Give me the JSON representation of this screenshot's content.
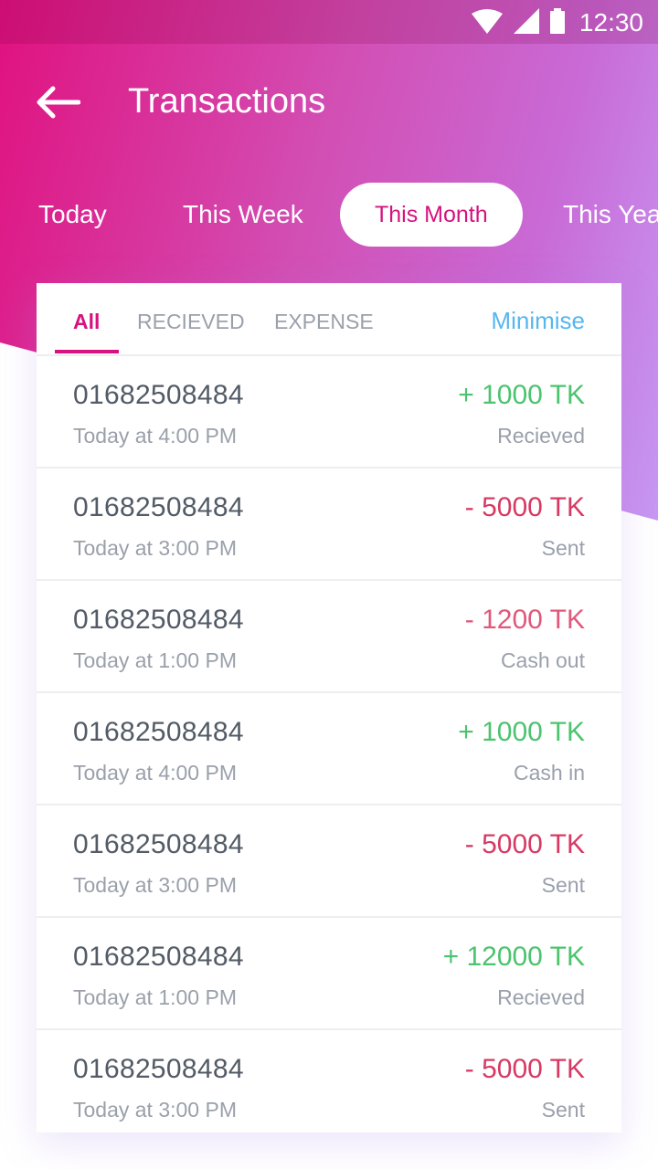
{
  "status": {
    "time": "12:30"
  },
  "header": {
    "title": "Transactions"
  },
  "period_tabs": [
    "Today",
    "This Week",
    "This Month",
    "This Year"
  ],
  "active_period": "This Month",
  "filter_tabs": [
    "All",
    "RECIEVED",
    "EXPENSE"
  ],
  "active_filter": "All",
  "minimise_label": "Minimise",
  "colors": {
    "accent": "#d6127f",
    "received": "#4cc36e",
    "expense": "#d63a63",
    "cashout": "#e0587a",
    "link": "#56b6f2"
  },
  "transactions": [
    {
      "number": "01682508484",
      "time": "Today at 4:00 PM",
      "amount": "+ 1000 TK",
      "type": "Recieved",
      "direction": "in"
    },
    {
      "number": "01682508484",
      "time": "Today at 3:00 PM",
      "amount": "- 5000 TK",
      "type": "Sent",
      "direction": "out"
    },
    {
      "number": "01682508484",
      "time": "Today at 1:00 PM",
      "amount": "- 1200 TK",
      "type": "Cash out",
      "direction": "out-light"
    },
    {
      "number": "01682508484",
      "time": "Today at 4:00 PM",
      "amount": "+ 1000 TK",
      "type": "Cash in",
      "direction": "in"
    },
    {
      "number": "01682508484",
      "time": "Today at 3:00 PM",
      "amount": "- 5000 TK",
      "type": "Sent",
      "direction": "out"
    },
    {
      "number": "01682508484",
      "time": "Today at 1:00 PM",
      "amount": "+ 12000 TK",
      "type": "Recieved",
      "direction": "in"
    },
    {
      "number": "01682508484",
      "time": "Today at 3:00 PM",
      "amount": "- 5000 TK",
      "type": "Sent",
      "direction": "out"
    }
  ]
}
